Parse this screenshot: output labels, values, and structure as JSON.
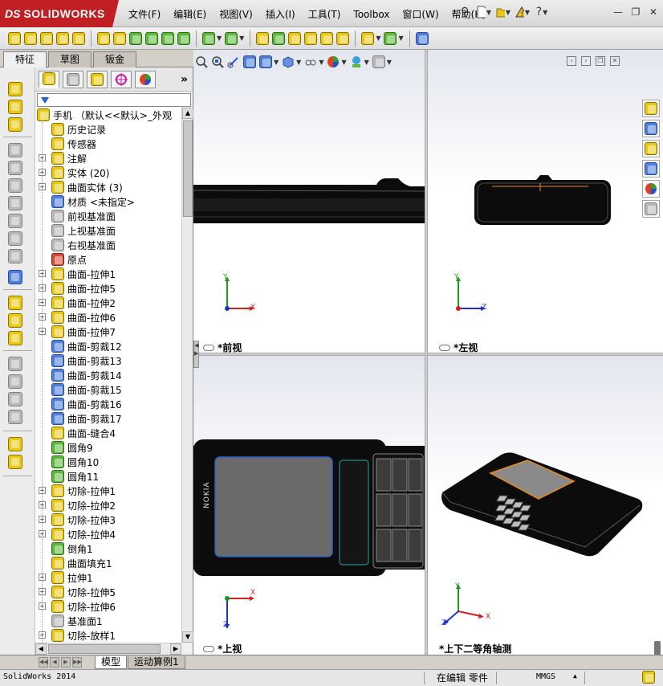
{
  "app": {
    "logo_ds": "DS",
    "logo_name": "SOLIDWORKS"
  },
  "menu": [
    "文件(F)",
    "编辑(E)",
    "视图(V)",
    "插入(I)",
    "工具(T)",
    "Toolbox",
    "窗口(W)",
    "帮助(H)"
  ],
  "command_manager": {
    "tabs": [
      "特征",
      "草图",
      "钣金"
    ],
    "active_tab": "特征"
  },
  "feature_tree": {
    "root": "手机 （默认<<默认>_外观",
    "items": [
      {
        "label": "历史记录",
        "icon": "history-icon",
        "expandable": false
      },
      {
        "label": "传感器",
        "icon": "sensor-icon",
        "expandable": false
      },
      {
        "label": "注解",
        "icon": "annotation-icon",
        "expandable": true
      },
      {
        "label": "实体 (20)",
        "icon": "solid-bodies-icon",
        "expandable": true
      },
      {
        "label": "曲面实体 (3)",
        "icon": "surface-bodies-icon",
        "expandable": true
      },
      {
        "label": "材质 <未指定>",
        "icon": "material-icon",
        "expandable": false
      },
      {
        "label": "前视基准面",
        "icon": "plane-icon",
        "expandable": false
      },
      {
        "label": "上视基准面",
        "icon": "plane-icon",
        "expandable": false
      },
      {
        "label": "右视基准面",
        "icon": "plane-icon",
        "expandable": false
      },
      {
        "label": "原点",
        "icon": "origin-icon",
        "expandable": false
      },
      {
        "label": "曲面-拉伸1",
        "icon": "surface-extrude-icon",
        "expandable": true
      },
      {
        "label": "曲面-拉伸5",
        "icon": "surface-extrude-icon",
        "expandable": true
      },
      {
        "label": "曲面-拉伸2",
        "icon": "surface-extrude-icon",
        "expandable": true
      },
      {
        "label": "曲面-拉伸6",
        "icon": "surface-extrude-icon",
        "expandable": true
      },
      {
        "label": "曲面-拉伸7",
        "icon": "surface-extrude-icon",
        "expandable": true
      },
      {
        "label": "曲面-剪裁12",
        "icon": "surface-trim-icon",
        "expandable": false
      },
      {
        "label": "曲面-剪裁13",
        "icon": "surface-trim-icon",
        "expandable": false
      },
      {
        "label": "曲面-剪裁14",
        "icon": "surface-trim-icon",
        "expandable": false
      },
      {
        "label": "曲面-剪裁15",
        "icon": "surface-trim-icon",
        "expandable": false
      },
      {
        "label": "曲面-剪裁16",
        "icon": "surface-trim-icon",
        "expandable": false
      },
      {
        "label": "曲面-剪裁17",
        "icon": "surface-trim-icon",
        "expandable": false
      },
      {
        "label": "曲面-缝合4",
        "icon": "surface-knit-icon",
        "expandable": false
      },
      {
        "label": "圆角9",
        "icon": "fillet-icon",
        "expandable": false
      },
      {
        "label": "圆角10",
        "icon": "fillet-icon",
        "expandable": false
      },
      {
        "label": "圆角11",
        "icon": "fillet-icon",
        "expandable": false
      },
      {
        "label": "切除-拉伸1",
        "icon": "cut-extrude-icon",
        "expandable": true
      },
      {
        "label": "切除-拉伸2",
        "icon": "cut-extrude-icon",
        "expandable": true
      },
      {
        "label": "切除-拉伸3",
        "icon": "cut-extrude-icon",
        "expandable": true
      },
      {
        "label": "切除-拉伸4",
        "icon": "cut-extrude-icon",
        "expandable": true
      },
      {
        "label": "倒角1",
        "icon": "chamfer-icon",
        "expandable": false
      },
      {
        "label": "曲面填充1",
        "icon": "surface-fill-icon",
        "expandable": false
      },
      {
        "label": "拉伸1",
        "icon": "boss-extrude-icon",
        "expandable": true
      },
      {
        "label": "切除-拉伸5",
        "icon": "cut-extrude-icon",
        "expandable": true
      },
      {
        "label": "切除-拉伸6",
        "icon": "cut-extrude-icon",
        "expandable": true
      },
      {
        "label": "基准面1",
        "icon": "plane-icon",
        "expandable": false
      },
      {
        "label": "切除-放样1",
        "icon": "cut-loft-icon",
        "expandable": true
      }
    ]
  },
  "viewports": {
    "front": "*前视",
    "left": "*左视",
    "top": "*上视",
    "iso": "*上下二等角轴测"
  },
  "axes": {
    "x": "X",
    "y": "Y",
    "z": "Z"
  },
  "phone_brand": "NOKIA",
  "bottom_tabs": [
    "模型",
    "运动算例1"
  ],
  "active_bottom_tab": "模型",
  "status": {
    "version": "SolidWorks 2014",
    "state": "在编辑 零件",
    "units": "MMGS"
  },
  "colors": {
    "brand_red": "#c01f24",
    "screen_orange": "#e88a1a",
    "screen_blue": "#2a5fd0",
    "triad_red": "#d22020",
    "triad_green": "#1a9a1a",
    "triad_blue": "#2030d0"
  }
}
